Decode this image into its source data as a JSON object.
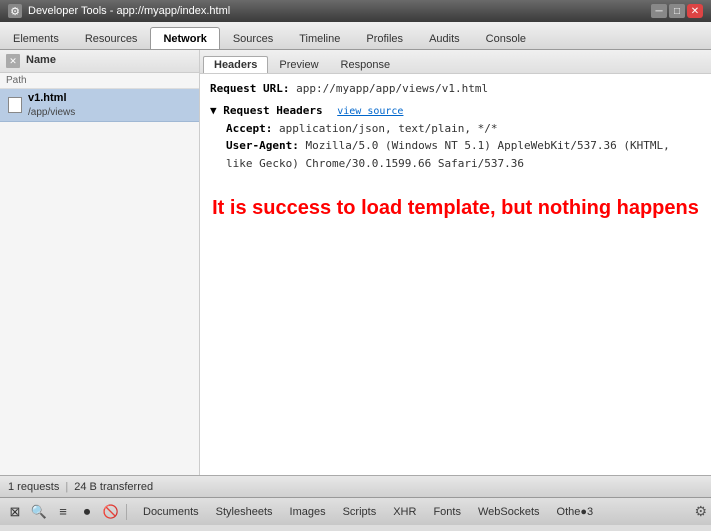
{
  "titlebar": {
    "title": "Developer Tools - app://myapp/index.html",
    "icon": "⚙",
    "minimize": "─",
    "maximize": "□",
    "close": "✕"
  },
  "nav": {
    "tabs": [
      {
        "label": "Elements",
        "active": false
      },
      {
        "label": "Resources",
        "active": false
      },
      {
        "label": "Network",
        "active": true
      },
      {
        "label": "Sources",
        "active": false
      },
      {
        "label": "Timeline",
        "active": false
      },
      {
        "label": "Profiles",
        "active": false
      },
      {
        "label": "Audits",
        "active": false
      },
      {
        "label": "Console",
        "active": false
      }
    ]
  },
  "left_panel": {
    "col1": "Name",
    "col2": "Path",
    "file": {
      "name": "v1.html",
      "path": "/app/views"
    }
  },
  "sub_tabs": [
    {
      "label": "Headers",
      "active": true
    },
    {
      "label": "Preview",
      "active": false
    },
    {
      "label": "Response",
      "active": false
    }
  ],
  "headers": {
    "request_url_label": "Request URL:",
    "request_url_value": "app://myapp/app/views/v1.html",
    "request_headers_label": "▼ Request Headers",
    "view_source": "view source",
    "accept_label": "Accept:",
    "accept_value": "application/json, text/plain, */*",
    "user_agent_label": "User-Agent:",
    "user_agent_value": "Mozilla/5.0 (Windows NT 5.1) AppleWebKit/537.36 (KHTML, like Gecko) Chrome/30.0.1599.66 Safari/537.36"
  },
  "success_message": "It is success to load template, but nothing happens",
  "status_bar": {
    "requests": "1 requests",
    "separator": "|",
    "transferred": "24 B transferred"
  },
  "bottom_toolbar": {
    "filter_tabs": [
      {
        "label": "Documents",
        "active": false
      },
      {
        "label": "Stylesheets",
        "active": false
      },
      {
        "label": "Images",
        "active": false
      },
      {
        "label": "Scripts",
        "active": false
      },
      {
        "label": "XHR",
        "active": false
      },
      {
        "label": "Fonts",
        "active": false
      },
      {
        "label": "WebSockets",
        "active": false
      },
      {
        "label": "Othe●3",
        "active": false
      }
    ]
  }
}
